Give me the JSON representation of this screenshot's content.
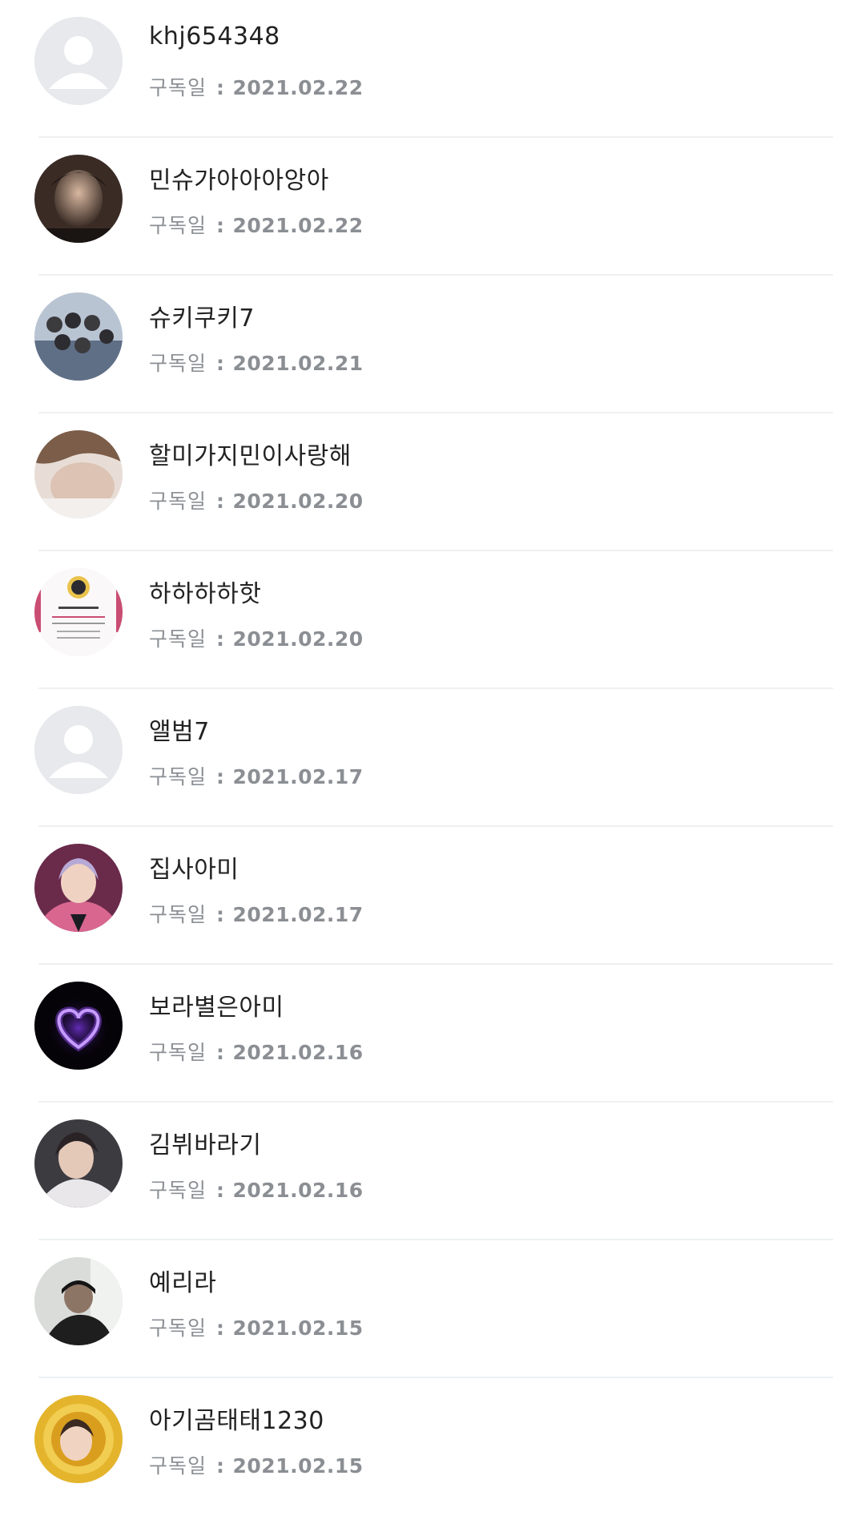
{
  "subscribers": {
    "date_label": "구독일",
    "separator": ":",
    "items": [
      {
        "name": "khj654348",
        "date": "2021.02.22",
        "avatar": "default-avatar-icon",
        "avatar_color": "#e7e9ec"
      },
      {
        "name": "민슈가아아아앙아",
        "date": "2021.02.22",
        "avatar": "profile-photo",
        "avatar_color": "#3a2c25"
      },
      {
        "name": "슈키쿠키7",
        "date": "2021.02.21",
        "avatar": "profile-photo",
        "avatar_color": "#7f92ab"
      },
      {
        "name": "할미가지민이사랑해",
        "date": "2021.02.20",
        "avatar": "profile-photo",
        "avatar_color": "#c9b8ae"
      },
      {
        "name": "하하하하핫",
        "date": "2021.02.20",
        "avatar": "profile-photo",
        "avatar_color": "#f7f2f4"
      },
      {
        "name": "앨범7",
        "date": "2021.02.17",
        "avatar": "default-avatar-icon",
        "avatar_color": "#e7e9ec"
      },
      {
        "name": "집사아미",
        "date": "2021.02.17",
        "avatar": "profile-photo",
        "avatar_color": "#a3476d"
      },
      {
        "name": "보라별은아미",
        "date": "2021.02.16",
        "avatar": "heart-icon",
        "avatar_color": "#050308"
      },
      {
        "name": "김뷔바라기",
        "date": "2021.02.16",
        "avatar": "profile-photo",
        "avatar_color": "#5a5a5e"
      },
      {
        "name": "예리라",
        "date": "2021.02.15",
        "avatar": "profile-photo",
        "avatar_color": "#4a4a4a"
      },
      {
        "name": "아기곰태태1230",
        "date": "2021.02.15",
        "avatar": "profile-photo",
        "avatar_color": "#e4b52c"
      }
    ]
  }
}
